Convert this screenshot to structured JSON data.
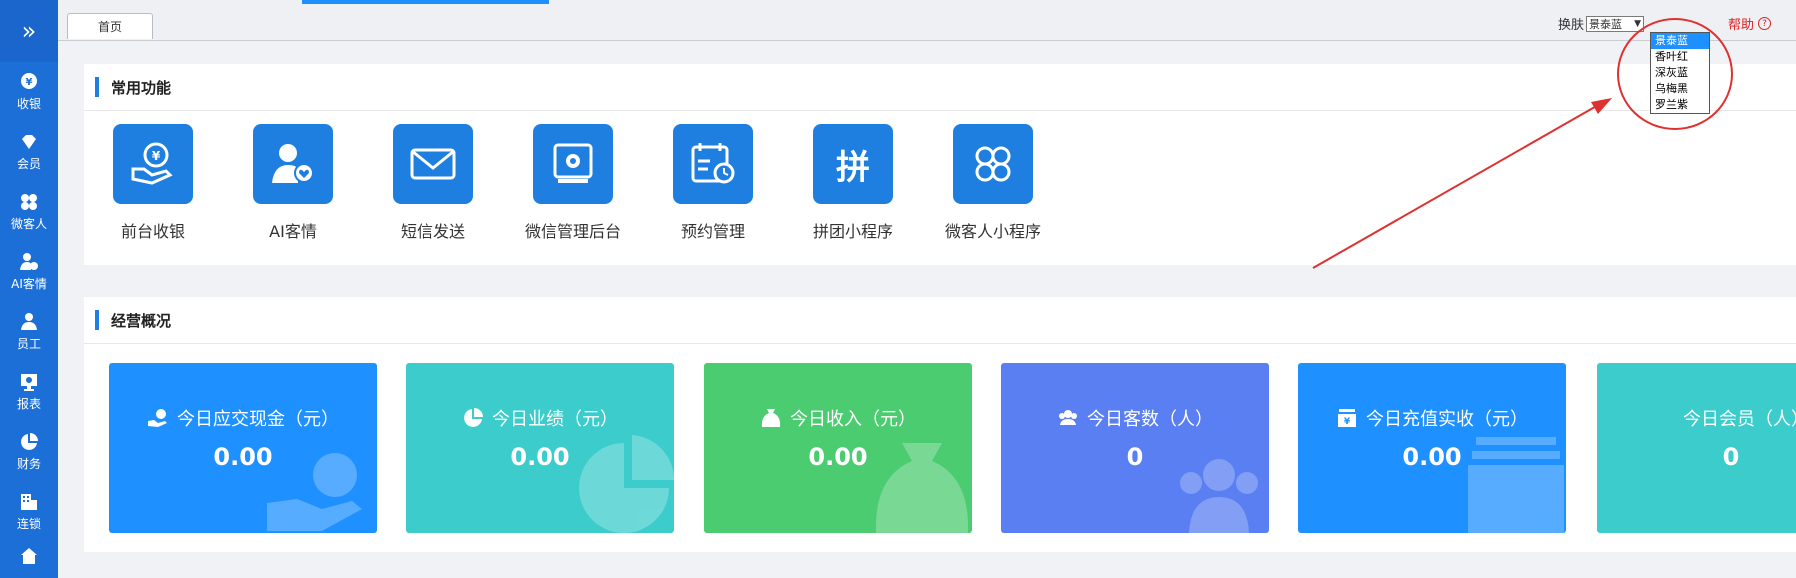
{
  "sidebar": {
    "toggle_icon": "double-chevron-right-icon",
    "items": [
      {
        "label": "收银",
        "icon": "yen-coin-icon"
      },
      {
        "label": "会员",
        "icon": "diamond-icon"
      },
      {
        "label": "微客人",
        "icon": "clover-icon"
      },
      {
        "label": "AI客情",
        "icon": "user-heart-icon"
      },
      {
        "label": "员工",
        "icon": "person-icon"
      },
      {
        "label": "报表",
        "icon": "monitor-icon"
      },
      {
        "label": "财务",
        "icon": "pie-chart-icon"
      },
      {
        "label": "连锁",
        "icon": "building-icon"
      }
    ]
  },
  "topbar": {
    "tab": "首页",
    "theme_label": "换肤",
    "theme_selected": "景泰蓝",
    "theme_options": [
      "景泰蓝",
      "香叶红",
      "深灰蓝",
      "乌梅黑",
      "罗兰紫"
    ],
    "help_label": "帮助",
    "help_icon": "?"
  },
  "common": {
    "title": "常用功能",
    "items": [
      {
        "label": "前台收银",
        "icon": "cashier-icon"
      },
      {
        "label": "AI客情",
        "icon": "user-heart-icon"
      },
      {
        "label": "短信发送",
        "icon": "envelope-icon"
      },
      {
        "label": "微信管理后台",
        "icon": "wechat-admin-icon"
      },
      {
        "label": "预约管理",
        "icon": "calendar-clock-icon"
      },
      {
        "label": "拼团小程序",
        "icon": "pin-text-icon",
        "glyph": "拼"
      },
      {
        "label": "微客人小程序",
        "icon": "clover-outline-icon"
      }
    ]
  },
  "overview": {
    "title": "经营概况",
    "cards": [
      {
        "label": "今日应交现金（元）",
        "value": "0.00",
        "color": "#1e90ff",
        "icon": "cash-hand-icon"
      },
      {
        "label": "今日业绩（元）",
        "value": "0.00",
        "color": "#3ccccc",
        "icon": "pie-chart-icon"
      },
      {
        "label": "今日收入（元）",
        "value": "0.00",
        "color": "#4ccc70",
        "icon": "money-bag-icon"
      },
      {
        "label": "今日客数（人）",
        "value": "0",
        "color": "#5a7ff2",
        "icon": "group-icon"
      },
      {
        "label": "今日充值实收（元）",
        "value": "0.00",
        "color": "#1e90ff",
        "icon": "recharge-icon"
      },
      {
        "label": "今日会员（人）",
        "value": "0",
        "color": "#3ccccc",
        "icon": "member-card-icon"
      }
    ]
  }
}
